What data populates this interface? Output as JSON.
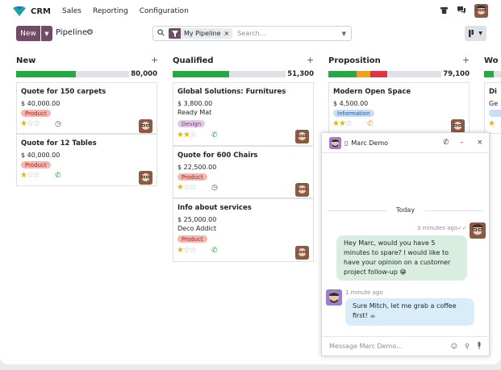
{
  "topbar": {
    "app": "CRM",
    "menu": [
      "Sales",
      "Reporting",
      "Configuration"
    ]
  },
  "controls": {
    "new_label": "New",
    "title": "Pipeline",
    "facet": "My Pipeline",
    "facet_remove": "×",
    "search_placeholder": "Search..."
  },
  "columns": [
    {
      "title": "New",
      "total": "80,000"
    },
    {
      "title": "Qualified",
      "total": "51,300"
    },
    {
      "title": "Proposition",
      "total": "79,100"
    },
    {
      "title": "Wo"
    }
  ],
  "bars": {
    "new": [
      {
        "fraction": 0.53,
        "color": "#28a745"
      }
    ],
    "qualified": [
      {
        "fraction": 0.5,
        "color": "#28a745"
      }
    ],
    "proposition": [
      {
        "fraction": 0.25,
        "color": "#28a745"
      },
      {
        "fraction": 0.12,
        "color": "#f0a020"
      },
      {
        "fraction": 0.15,
        "color": "#dc3545"
      }
    ]
  },
  "cards": {
    "new1": {
      "title": "Quote for 150 carpets",
      "amount": "$ 40,000.00",
      "tag": "Product",
      "stars": 1,
      "activity": "clock-icon"
    },
    "new2": {
      "title": "Quote for 12 Tables",
      "amount": "$ 40,000.00",
      "tag": "Product",
      "stars": 1,
      "activity": "phone-icon"
    },
    "qual1": {
      "title": "Global Solutions: Furnitures",
      "amount": "$ 3,800.00",
      "company": "Ready Mat",
      "tag": "Design",
      "stars": 2,
      "activity": "phone-icon"
    },
    "qual2": {
      "title": "Quote for 600 Chairs",
      "amount": "$ 22,500.00",
      "tag": "Product",
      "stars": 1,
      "activity": "clock-icon"
    },
    "qual3": {
      "title": "Info about services",
      "amount": "$ 25,000.00",
      "company": "Deco Addict",
      "tag": "Product",
      "stars": 1,
      "activity": "phone-icon"
    },
    "prop1": {
      "title": "Modern Open Space",
      "amount": "$ 4,500.00",
      "tag": "Information",
      "stars": 2,
      "activity": "phone-icon"
    },
    "wo1": {
      "title": "Di",
      "company": "Ge"
    }
  },
  "chat": {
    "name": "Marc Demo",
    "day_separator": "Today",
    "msg1_time": "3 minutes ago",
    "msg1_text": "Hey Marc, would you have 5 minutes to spare? I would like to have your opinion on a customer project follow-up 😁",
    "msg2_time": "1 minute ago",
    "msg2_text": "Sure Mitch, let me grab a coffee first! ☕",
    "composer_placeholder": "Message Marc Demo..."
  }
}
